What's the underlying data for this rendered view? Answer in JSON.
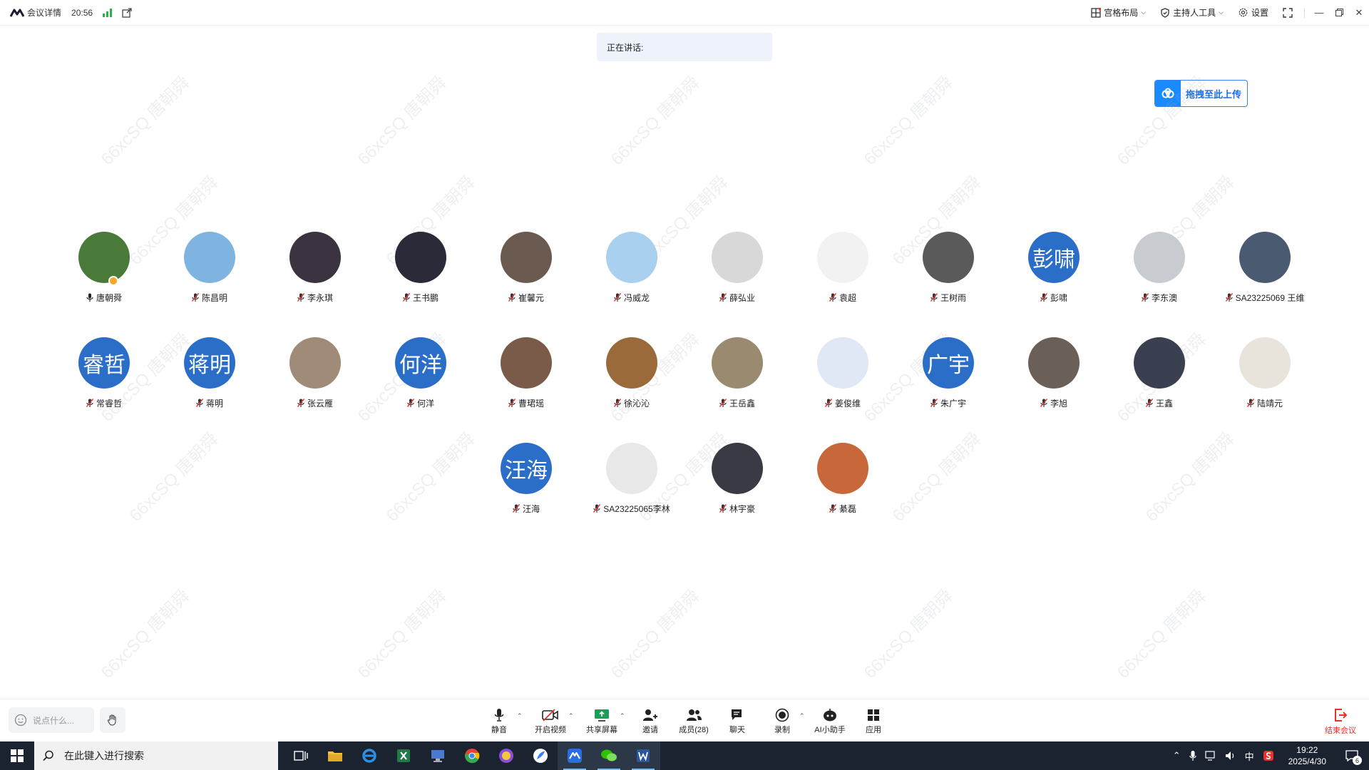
{
  "titlebar": {
    "app_name": "会议详情",
    "time": "20:56",
    "layout_label": "宫格布局",
    "host_tools_label": "主持人工具",
    "settings_label": "设置"
  },
  "speaking": {
    "label": "正在讲话:"
  },
  "upload": {
    "label": "拖拽至此上传"
  },
  "watermark": {
    "text": "66xcSQ 唐朝舜"
  },
  "participants": [
    {
      "name": "唐朝舜",
      "avatar_text": "",
      "color": "#4a7a3a",
      "host": true
    },
    {
      "name": "陈昌明",
      "avatar_text": "",
      "color": "#7fb3e0"
    },
    {
      "name": "李永琪",
      "avatar_text": "",
      "color": "#3b3440"
    },
    {
      "name": "王书鹏",
      "avatar_text": "",
      "color": "#2a2a38"
    },
    {
      "name": "崔馨元",
      "avatar_text": "",
      "color": "#6b5a50"
    },
    {
      "name": "冯威龙",
      "avatar_text": "",
      "color": "#a9d0ee"
    },
    {
      "name": "薛弘业",
      "avatar_text": "",
      "color": "#d8d8d8"
    },
    {
      "name": "袁超",
      "avatar_text": "",
      "color": "#f2f2f2"
    },
    {
      "name": "王树雨",
      "avatar_text": "",
      "color": "#5a5a5a"
    },
    {
      "name": "彭啸",
      "avatar_text": "彭啸",
      "color": "#2b6ec8"
    },
    {
      "name": "李东澳",
      "avatar_text": "",
      "color": "#c8cbd0"
    },
    {
      "name": "SA23225069 王维",
      "avatar_text": "",
      "color": "#4a5a70"
    },
    {
      "name": "常睿哲",
      "avatar_text": "睿哲",
      "color": "#2b6ec8"
    },
    {
      "name": "蒋明",
      "avatar_text": "蒋明",
      "color": "#2b6ec8"
    },
    {
      "name": "张云雁",
      "avatar_text": "",
      "color": "#a08a78"
    },
    {
      "name": "何洋",
      "avatar_text": "何洋",
      "color": "#2b6ec8"
    },
    {
      "name": "曹珺瑶",
      "avatar_text": "",
      "color": "#7a5a48"
    },
    {
      "name": "徐沁沁",
      "avatar_text": "",
      "color": "#9a6a3a"
    },
    {
      "name": "王岳鑫",
      "avatar_text": "",
      "color": "#9a8a70"
    },
    {
      "name": "姜俊维",
      "avatar_text": "",
      "color": "#dfe8f4"
    },
    {
      "name": "朱广宇",
      "avatar_text": "广宇",
      "color": "#2b6ec8"
    },
    {
      "name": "李旭",
      "avatar_text": "",
      "color": "#6a6058"
    },
    {
      "name": "王鑫",
      "avatar_text": "",
      "color": "#3a4050"
    },
    {
      "name": "陆靖元",
      "avatar_text": "",
      "color": "#e8e4dc"
    },
    {
      "name": "汪海",
      "avatar_text": "汪海",
      "color": "#2b6ec8"
    },
    {
      "name": "SA23225065李林",
      "avatar_text": "",
      "color": "#e8e8e8"
    },
    {
      "name": "林宇豪",
      "avatar_text": "",
      "color": "#3a3a44"
    },
    {
      "name": "綦磊",
      "avatar_text": "",
      "color": "#c8683a"
    }
  ],
  "toolbar": {
    "chat_placeholder": "说点什么...",
    "mute_label": "静音",
    "video_label": "开启视频",
    "share_label": "共享屏幕",
    "invite_label": "邀请",
    "members_label": "成员(28)",
    "chat_label": "聊天",
    "record_label": "录制",
    "ai_label": "AI小助手",
    "apps_label": "应用",
    "end_label": "结束会议"
  },
  "taskbar": {
    "search_placeholder": "在此键入进行搜索",
    "ime": "中",
    "clock_time": "19:22",
    "clock_date": "2025/4/30",
    "notifications": "6"
  }
}
